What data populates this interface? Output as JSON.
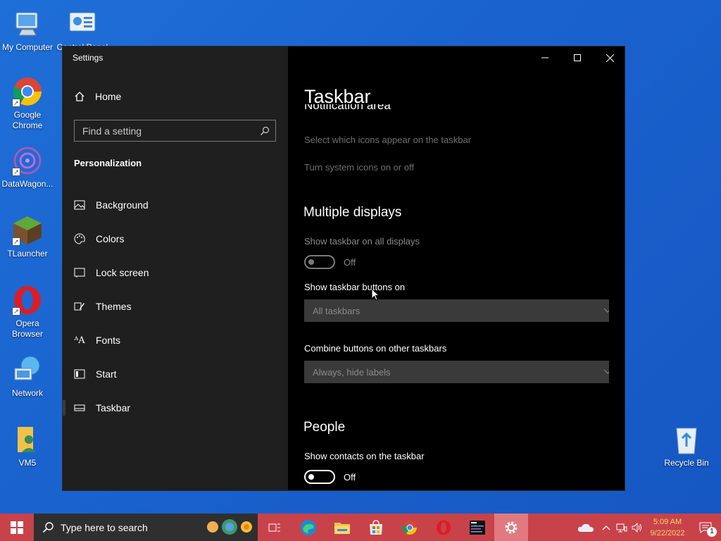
{
  "desktop": {
    "icons": [
      {
        "label": "My Computer",
        "icon": "computer-icon"
      },
      {
        "label": "Control Panel",
        "icon": "control-panel-icon"
      },
      {
        "label": "Google Chrome",
        "icon": "chrome-icon"
      },
      {
        "label": "DataWagon...",
        "icon": "datawagon-icon"
      },
      {
        "label": "TLauncher",
        "icon": "tlauncher-icon"
      },
      {
        "label": "Opera Browser",
        "icon": "opera-icon"
      },
      {
        "label": "Network",
        "icon": "network-icon"
      },
      {
        "label": "VM5",
        "icon": "user-folder-icon"
      },
      {
        "label": "Recycle Bin",
        "icon": "recycle-bin-icon"
      }
    ]
  },
  "window": {
    "title": "Settings",
    "controls": [
      "minimize",
      "maximize",
      "close"
    ]
  },
  "sidebar": {
    "home_label": "Home",
    "search_placeholder": "Find a setting",
    "section": "Personalization",
    "items": [
      {
        "label": "Background",
        "icon": "image-icon"
      },
      {
        "label": "Colors",
        "icon": "palette-icon"
      },
      {
        "label": "Lock screen",
        "icon": "lock-screen-icon"
      },
      {
        "label": "Themes",
        "icon": "brush-icon"
      },
      {
        "label": "Fonts",
        "icon": "fonts-icon"
      },
      {
        "label": "Start",
        "icon": "start-icon"
      },
      {
        "label": "Taskbar",
        "icon": "taskbar-icon",
        "selected": true
      }
    ]
  },
  "content": {
    "page_title": "Taskbar",
    "partial_heading": "Notification area",
    "notification_links": [
      "Select which icons appear on the taskbar",
      "Turn system icons on or off"
    ],
    "multiple_displays": {
      "heading": "Multiple displays",
      "show_on_all_label": "Show taskbar on all displays",
      "show_on_all_state": "Off",
      "buttons_on_label": "Show taskbar buttons on",
      "buttons_on_value": "All taskbars",
      "combine_label": "Combine buttons on other taskbars",
      "combine_value": "Always, hide labels"
    },
    "people": {
      "heading": "People",
      "show_contacts_label": "Show contacts on the taskbar",
      "show_contacts_state": "Off"
    }
  },
  "taskbar": {
    "search_placeholder": "Type here to search",
    "pinned": [
      "task-view-icon",
      "edge-icon",
      "file-explorer-icon",
      "store-icon",
      "chrome-icon",
      "opera-icon",
      "terminal-icon",
      "settings-icon"
    ],
    "clock_time": "5:09 AM",
    "clock_date": "9/22/2022",
    "notification_count": "1",
    "colors": {
      "taskbar": "#c8424a",
      "clock": "#f4d66a"
    }
  }
}
